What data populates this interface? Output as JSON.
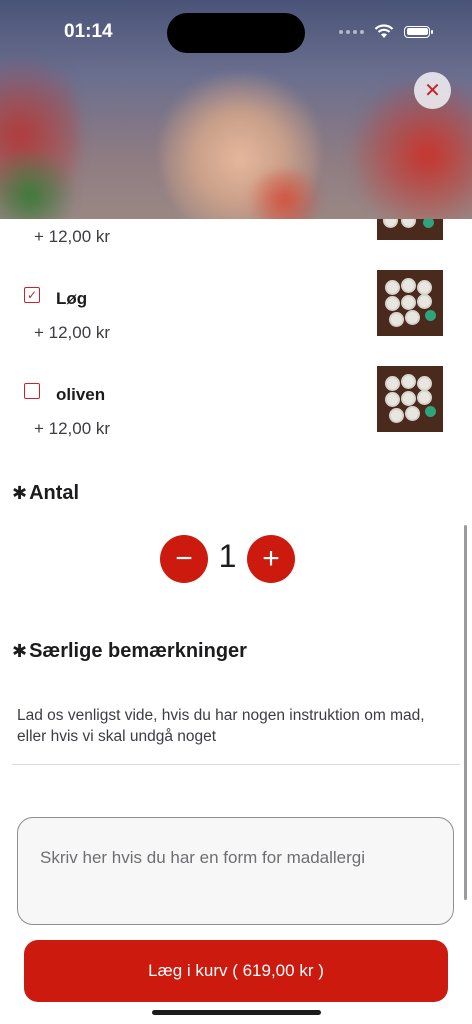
{
  "status": {
    "time": "01:14"
  },
  "header": {
    "close_icon": "close-icon"
  },
  "options": [
    {
      "name": "",
      "price": "+ 12,00 kr",
      "checked": false,
      "partial": true
    },
    {
      "name": "Løg",
      "price": "+ 12,00 kr",
      "checked": true
    },
    {
      "name": "oliven",
      "price": "+ 12,00 kr",
      "checked": false
    }
  ],
  "quantity": {
    "title": "Antal",
    "value": "1",
    "minus": "−",
    "plus": "+"
  },
  "remarks": {
    "title": "Særlige bemærkninger",
    "description": "Lad os venligst vide, hvis du har nogen instruktion om mad, eller hvis vi skal undgå noget",
    "placeholder": "Skriv her hvis du har en form for madallergi"
  },
  "cart_button": {
    "label": "Læg i kurv ( 619,00 kr )"
  },
  "colors": {
    "accent": "#cc1a0e"
  }
}
